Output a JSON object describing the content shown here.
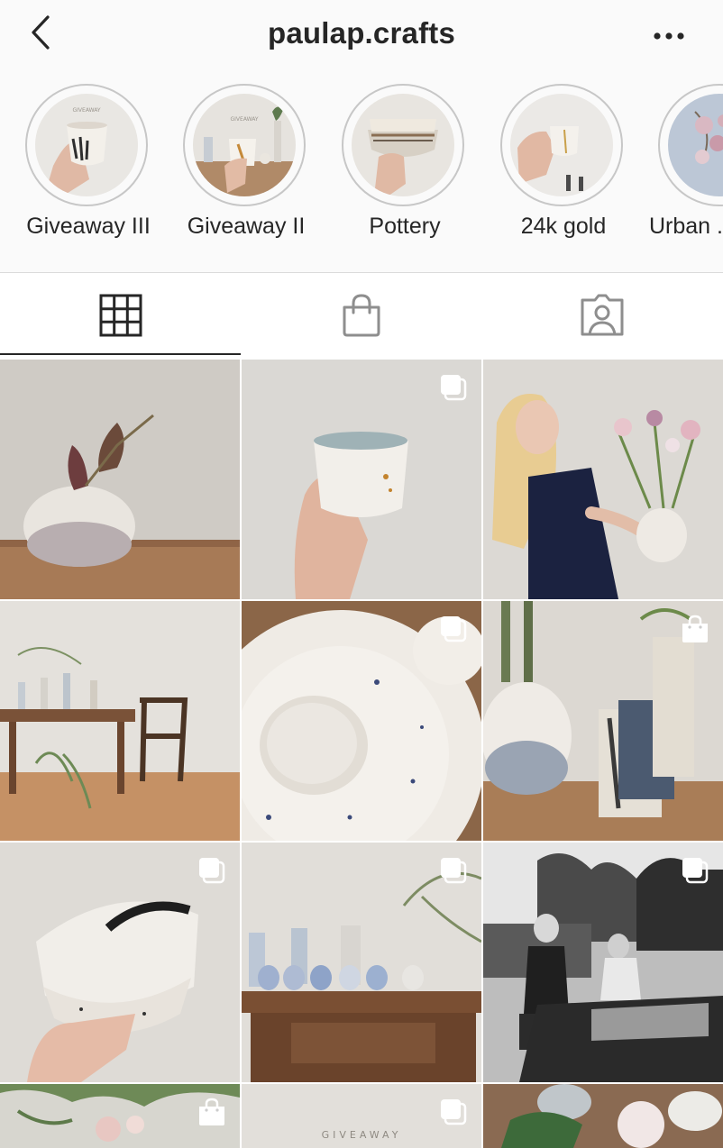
{
  "header": {
    "username": "paulap.crafts",
    "back_icon": "chevron-left-icon",
    "more_icon": "ellipsis-icon"
  },
  "highlights": [
    {
      "label": "Giveaway III"
    },
    {
      "label": "Giveaway II"
    },
    {
      "label": "Pottery"
    },
    {
      "label": "24k gold"
    },
    {
      "label": "Urban ..."
    }
  ],
  "tabs": [
    {
      "name": "posts",
      "icon": "grid-icon",
      "active": true
    },
    {
      "name": "shop",
      "icon": "shopping-bag-icon",
      "active": false
    },
    {
      "name": "tagged",
      "icon": "tagged-person-icon",
      "active": false
    }
  ],
  "posts": [
    {
      "subject": "vase with artichoke flowers",
      "badge": "none"
    },
    {
      "subject": "hand holding ceramic cup",
      "badge": "carousel-icon"
    },
    {
      "subject": "woman holding vase with flowers",
      "badge": "none"
    },
    {
      "subject": "table with vases and chair",
      "badge": "none"
    },
    {
      "subject": "speckled plates and bowl",
      "badge": "carousel-icon"
    },
    {
      "subject": "vases on wooden table",
      "badge": "shopping-bag-icon"
    },
    {
      "subject": "hand holding brushed bowls",
      "badge": "carousel-icon"
    },
    {
      "subject": "cups on wooden desk",
      "badge": "carousel-icon"
    },
    {
      "subject": "couple with vintage car",
      "badge": "carousel-icon"
    },
    {
      "subject": "flowers and greenery",
      "badge": "shopping-bag-icon"
    },
    {
      "subject": "giveaway pottery",
      "badge": "carousel-icon",
      "overlay_text": "GIVEAWAY"
    },
    {
      "subject": "flowers and bowls",
      "badge": "none"
    }
  ],
  "colors": {
    "text": "#262626",
    "ring": "#c7c7c7",
    "divider": "#dbdbdb",
    "header_bg": "#fafafa"
  }
}
